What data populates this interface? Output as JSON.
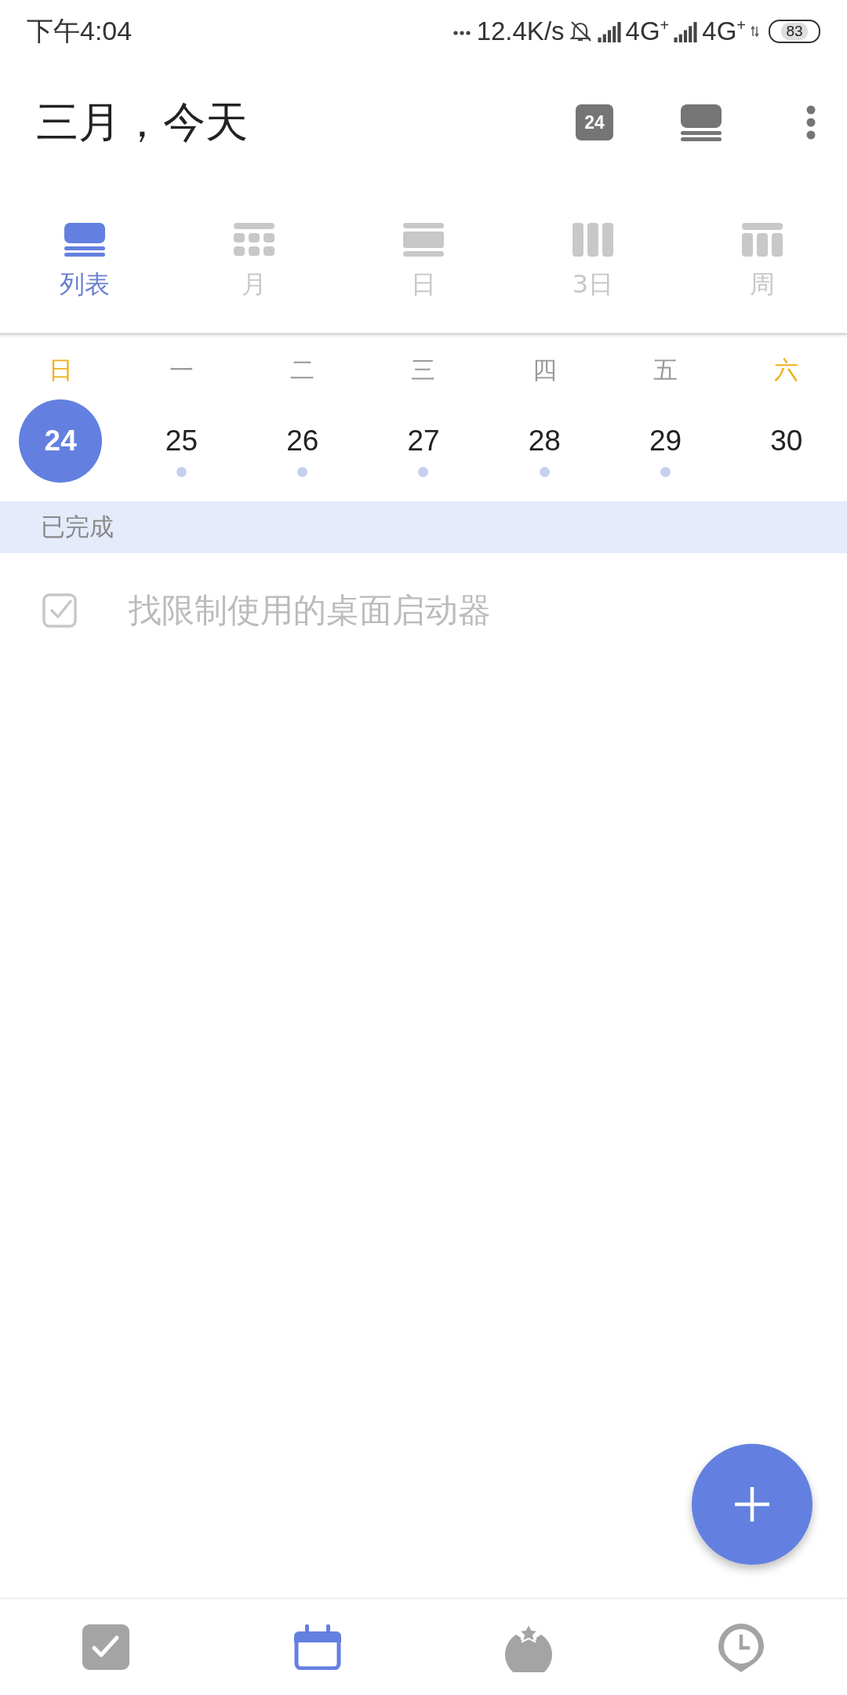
{
  "status_bar": {
    "time": "下午4:04",
    "speed": "12.4K/s",
    "network_1": "4G$^{+}$",
    "network_2": "4G$^{+}$",
    "battery": "83"
  },
  "header": {
    "title": "三月，今天",
    "today_badge": "24"
  },
  "view_tabs": [
    {
      "kind": "list",
      "label": "列表",
      "selected": true
    },
    {
      "kind": "month",
      "label": "月",
      "selected": false
    },
    {
      "kind": "day",
      "label": "日",
      "selected": false
    },
    {
      "kind": "three_day",
      "label": "3日",
      "selected": false
    },
    {
      "kind": "week",
      "label": "周",
      "selected": false
    }
  ],
  "weekdays": [
    {
      "label": "日",
      "weekend": true
    },
    {
      "label": "一",
      "weekend": false
    },
    {
      "label": "二",
      "weekend": false
    },
    {
      "label": "三",
      "weekend": false
    },
    {
      "label": "四",
      "weekend": false
    },
    {
      "label": "五",
      "weekend": false
    },
    {
      "label": "六",
      "weekend": true
    }
  ],
  "dates": [
    {
      "day": "24",
      "selected": true,
      "has_events": false
    },
    {
      "day": "25",
      "selected": false,
      "has_events": true
    },
    {
      "day": "26",
      "selected": false,
      "has_events": true
    },
    {
      "day": "27",
      "selected": false,
      "has_events": true
    },
    {
      "day": "28",
      "selected": false,
      "has_events": true
    },
    {
      "day": "29",
      "selected": false,
      "has_events": true
    },
    {
      "day": "30",
      "selected": false,
      "has_events": false
    }
  ],
  "section": {
    "title": "已完成"
  },
  "tasks": [
    {
      "title": "找限制使用的桌面启动器",
      "checked": true
    }
  ],
  "bottom_nav": [
    {
      "kind": "tasks",
      "selected": false
    },
    {
      "kind": "calendar",
      "selected": true
    },
    {
      "kind": "pomodoro",
      "selected": false
    },
    {
      "kind": "clock",
      "selected": false
    }
  ]
}
